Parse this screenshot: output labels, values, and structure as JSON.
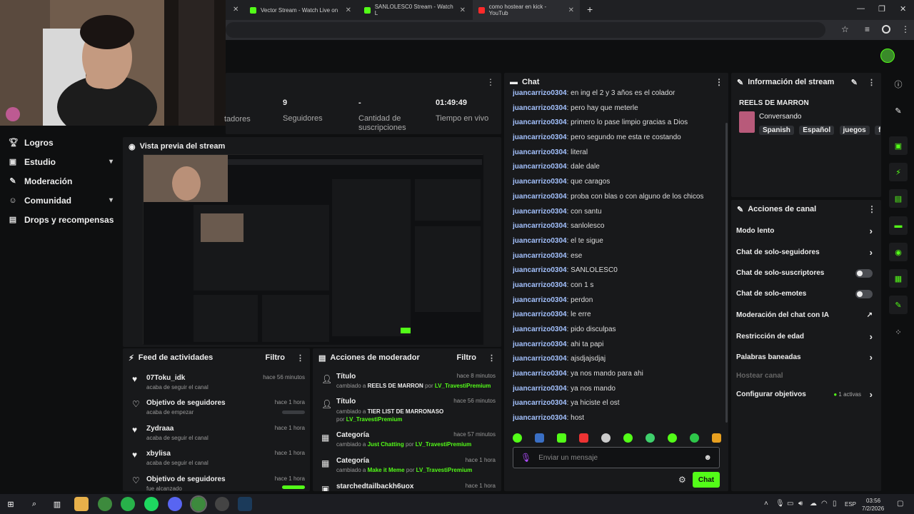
{
  "browser": {
    "tabs": [
      {
        "title": "Vector Stream - Watch Live on"
      },
      {
        "title": "SANLOLESC0 Stream - Watch L"
      },
      {
        "title": "como hostear en kick - YouTub"
      }
    ],
    "new_tab_label": "+"
  },
  "nav": {
    "items": [
      {
        "label": "Logros",
        "icon": "trophy-icon"
      },
      {
        "label": "Estudio",
        "icon": "studio-icon",
        "expandable": true
      },
      {
        "label": "Moderación",
        "icon": "wrench-icon"
      },
      {
        "label": "Comunidad",
        "icon": "community-icon",
        "expandable": true
      },
      {
        "label": "Drops y recompensas",
        "icon": "drops-icon"
      }
    ]
  },
  "stats": [
    {
      "value": "",
      "label": "tadores"
    },
    {
      "value": "9",
      "label": "Seguidores"
    },
    {
      "value": "-",
      "label": "Cantidad de suscripciones"
    },
    {
      "value": "01:49:49",
      "label": "Tiempo en vivo"
    }
  ],
  "preview": {
    "title": "Vista previa del stream"
  },
  "feed": {
    "title": "Feed de actividades",
    "filter": "Filtro",
    "items": [
      {
        "title": "07Toku_idk",
        "sub": "acaba de seguir el canal",
        "when": "hace 56 minutos",
        "progress": null
      },
      {
        "title": "Objetivo de seguidores",
        "sub": "acaba de empezar",
        "when": "hace 1 hora",
        "progress": 0
      },
      {
        "title": "Zydraaa",
        "sub": "acaba de seguir el canal",
        "when": "hace 1 hora",
        "progress": null
      },
      {
        "title": "xbylisa",
        "sub": "acaba de seguir el canal",
        "when": "hace 1 hora",
        "progress": null
      },
      {
        "title": "Objetivo de seguidores",
        "sub": "fue alcanzado",
        "when": "hace 1 hora",
        "progress": 1
      }
    ]
  },
  "modactions": {
    "title": "Acciones de moderador",
    "filter": "Filtro",
    "items": [
      {
        "title": "Título",
        "prefix": "cambiado a",
        "value": "REELS DE MARRON",
        "by": "por",
        "user": "LV_TravestiPremium",
        "when": "hace 8 minutos"
      },
      {
        "title": "Título",
        "prefix": "cambiado a",
        "value": "TIER LIST DE MARRONASO",
        "by": "por",
        "user": "LV_TravestiPremium",
        "when": "hace 56 minutos"
      },
      {
        "title": "Categoría",
        "prefix": "cambiado a",
        "value": "Just Chatting",
        "by": "por",
        "user": "LV_TravestiPremium",
        "when": "hace 57 minutos"
      },
      {
        "title": "Categoría",
        "prefix": "cambiado a",
        "value": "Make it Meme",
        "by": "por",
        "user": "LV_TravestiPremium",
        "when": "hace 1 hora"
      },
      {
        "title": "starchedtailbackh6uox",
        "prefix": "",
        "value": "",
        "by": "",
        "user": "",
        "when": "hace 1 hora"
      }
    ]
  },
  "chat": {
    "title": "Chat",
    "messages": [
      {
        "user": "juancarrizo0304",
        "text": "en ing el 2 y 3 años es el colador"
      },
      {
        "user": "juancarrizo0304",
        "text": "pero hay que meterle"
      },
      {
        "user": "juancarrizo0304",
        "text": "primero lo pase limpio gracias a Dios"
      },
      {
        "user": "juancarrizo0304",
        "text": "pero segundo me esta re costando"
      },
      {
        "user": "juancarrizo0304",
        "text": "literal"
      },
      {
        "user": "juancarrizo0304",
        "text": "dale dale"
      },
      {
        "user": "juancarrizo0304",
        "text": "que caragos"
      },
      {
        "user": "juancarrizo0304",
        "text": "proba con blas o con alguno de los chicos"
      },
      {
        "user": "juancarrizo0304",
        "text": "con santu"
      },
      {
        "user": "juancarrizo0304",
        "text": "sanlolesco"
      },
      {
        "user": "juancarrizo0304",
        "text": "el te sigue"
      },
      {
        "user": "juancarrizo0304",
        "text": "ese"
      },
      {
        "user": "juancarrizo0304",
        "text": "SANLOLESC0"
      },
      {
        "user": "juancarrizo0304",
        "text": "con 1 s"
      },
      {
        "user": "juancarrizo0304",
        "text": "perdon"
      },
      {
        "user": "juancarrizo0304",
        "text": "le erre"
      },
      {
        "user": "juancarrizo0304",
        "text": "pido disculpas"
      },
      {
        "user": "juancarrizo0304",
        "text": "ahi ta papi"
      },
      {
        "user": "juancarrizo0304",
        "text": "ajsdjajsdjaj"
      },
      {
        "user": "juancarrizo0304",
        "text": "ya nos mando para ahi"
      },
      {
        "user": "juancarrizo0304",
        "text": "ya nos mando"
      },
      {
        "user": "juancarrizo0304",
        "text": "ya hiciste el ost"
      },
      {
        "user": "juancarrizo0304",
        "text": "host"
      }
    ],
    "input_placeholder": "Enviar un mensaje",
    "send_label": "Chat"
  },
  "stream_info": {
    "title": "Información del stream",
    "stream_title": "REELS DE MARRON",
    "category": "Conversando",
    "tags": [
      "Spanish",
      "Español",
      "juegos",
      "fu"
    ]
  },
  "channel_actions": {
    "title": "Acciones de canal",
    "items": [
      {
        "label": "Modo lento",
        "control": "chevron"
      },
      {
        "label": "Chat de solo-seguidores",
        "control": "chevron"
      },
      {
        "label": "Chat de solo-suscriptores",
        "control": "toggle"
      },
      {
        "label": "Chat de solo-emotes",
        "control": "toggle"
      },
      {
        "label": "Moderación del chat con IA",
        "control": "external"
      },
      {
        "label": "Restricción de edad",
        "control": "chevron"
      },
      {
        "label": "Palabras baneadas",
        "control": "chevron"
      },
      {
        "label": "Hostear canal",
        "control": "none"
      },
      {
        "label": "Configurar objetivos",
        "control": "chevron",
        "badge": "1 activas"
      }
    ]
  },
  "taskbar": {
    "language": "ESP",
    "time": "03:56",
    "date": "7/2/2026"
  },
  "colors": {
    "accent": "#53fc18",
    "panel": "#18191b",
    "background": "#0e0f10"
  }
}
